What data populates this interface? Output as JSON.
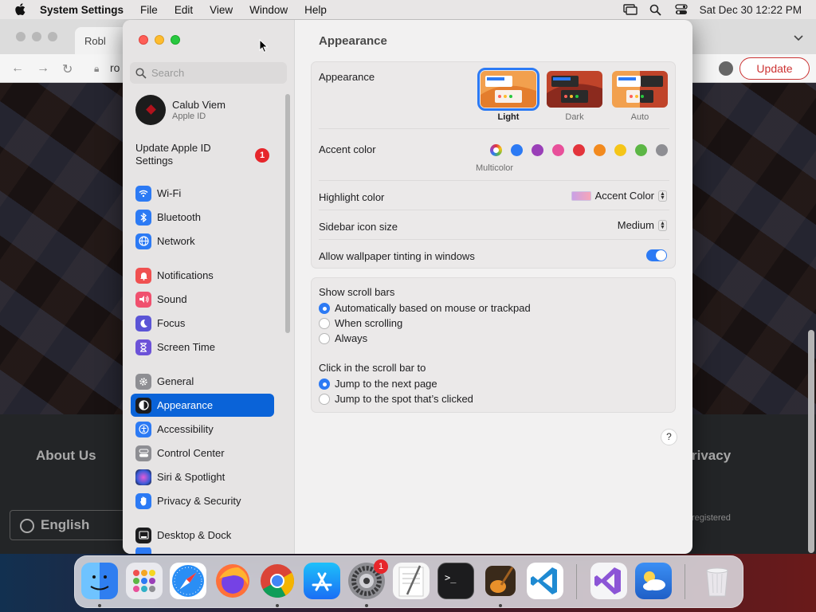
{
  "menubar": {
    "app_name": "System Settings",
    "menus": [
      "File",
      "Edit",
      "View",
      "Window",
      "Help"
    ],
    "clock": "Sat Dec 30  12:22 PM"
  },
  "browser": {
    "tab_title": "Robl",
    "url_partial": "ro",
    "update_label": "Update",
    "footer_left": "About Us",
    "footer_right": "rivacy",
    "footer_registered": "registered",
    "language": "English"
  },
  "sidebar": {
    "search_placeholder": "Search",
    "profile_name": "Calub Viem",
    "profile_sub": "Apple ID",
    "update_id_label": "Update Apple ID Settings",
    "update_badge": "1",
    "items": [
      {
        "label": "Wi-Fi",
        "icon": "wifi-icon",
        "color": "#2c7af4"
      },
      {
        "label": "Bluetooth",
        "icon": "bluetooth-icon",
        "color": "#2c7af4"
      },
      {
        "label": "Network",
        "icon": "globe-icon",
        "color": "#2c7af4"
      },
      {
        "label": "Notifications",
        "icon": "bell-icon",
        "color": "#f05050"
      },
      {
        "label": "Sound",
        "icon": "speaker-icon",
        "color": "#f0506e"
      },
      {
        "label": "Focus",
        "icon": "moon-icon",
        "color": "#5b54d6"
      },
      {
        "label": "Screen Time",
        "icon": "hourglass-icon",
        "color": "#6c52d8"
      },
      {
        "label": "General",
        "icon": "gear-icon",
        "color": "#8e8e93"
      },
      {
        "label": "Appearance",
        "icon": "appearance-icon",
        "color": "#1c1c1e"
      },
      {
        "label": "Accessibility",
        "icon": "accessibility-icon",
        "color": "#2c7af4"
      },
      {
        "label": "Control Center",
        "icon": "control-center-icon",
        "color": "#8e8e93"
      },
      {
        "label": "Siri & Spotlight",
        "icon": "siri-icon",
        "color": "#7a3fd0"
      },
      {
        "label": "Privacy & Security",
        "icon": "hand-icon",
        "color": "#2c7af4"
      },
      {
        "label": "Desktop & Dock",
        "icon": "dock-icon",
        "color": "#1c1c1e"
      }
    ]
  },
  "main": {
    "title": "Appearance",
    "appearance_label": "Appearance",
    "appearance_options": [
      "Light",
      "Dark",
      "Auto"
    ],
    "appearance_selected": "Light",
    "accent_label": "Accent color",
    "accent_colors": [
      "#2c7af4",
      "#9a3fb8",
      "#e8509a",
      "#e3343c",
      "#f28a1e",
      "#f5c518",
      "#5cb645",
      "#8e8e93"
    ],
    "multicolor_label": "Multicolor",
    "highlight_label": "Highlight color",
    "highlight_value": "Accent Color",
    "icon_size_label": "Sidebar icon size",
    "icon_size_value": "Medium",
    "tinting_label": "Allow wallpaper tinting in windows",
    "tinting_on": true,
    "scrollbars_label": "Show scroll bars",
    "scrollbar_options": [
      "Automatically based on mouse or trackpad",
      "When scrolling",
      "Always"
    ],
    "scrollbar_selected": 0,
    "click_label": "Click in the scroll bar to",
    "click_options": [
      "Jump to the next page",
      "Jump to the spot that’s clicked"
    ],
    "click_selected": 0,
    "help": "?"
  },
  "dock": {
    "apps": [
      "finder-icon",
      "launchpad-icon",
      "safari-icon",
      "firefox-icon",
      "chrome-icon",
      "app-store-icon",
      "system-settings-icon",
      "textedit-icon",
      "terminal-icon",
      "garageband-icon",
      "vscode-icon",
      "visual-studio-icon",
      "weather-icon",
      "trash-icon"
    ],
    "settings_badge": "1"
  }
}
